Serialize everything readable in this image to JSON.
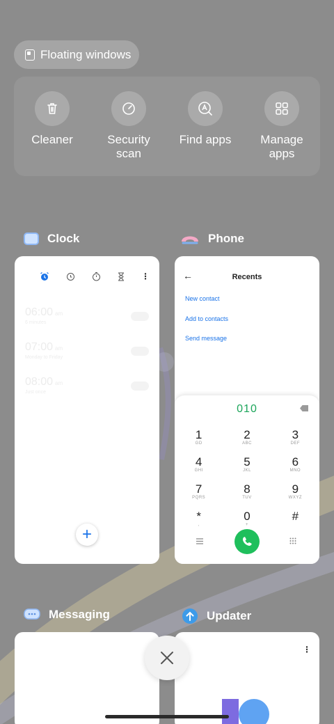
{
  "floating_windows": {
    "label": "Floating windows",
    "icon": "floating-window-icon"
  },
  "tools": [
    {
      "label": "Cleaner",
      "icon": "trash-icon"
    },
    {
      "label": "Security\nscan",
      "icon": "security-scan-icon"
    },
    {
      "label": "Find apps",
      "icon": "find-apps-icon"
    },
    {
      "label": "Manage\napps",
      "icon": "grid-icon"
    }
  ],
  "recent_apps": {
    "clock": {
      "name": "Clock",
      "alarms": [
        {
          "time": "06:00",
          "ampm": "am",
          "repeat": "6 minutes"
        },
        {
          "time": "07:00",
          "ampm": "am",
          "repeat": "Monday to Friday"
        },
        {
          "time": "08:00",
          "ampm": "am",
          "repeat": "Just once"
        }
      ]
    },
    "phone": {
      "name": "Phone",
      "title": "Recents",
      "links": [
        "New contact",
        "Add to contacts",
        "Send message"
      ],
      "dialed_number": "010",
      "keys": [
        {
          "digit": "1",
          "letters": "GD"
        },
        {
          "digit": "2",
          "letters": "ABC"
        },
        {
          "digit": "3",
          "letters": "DEF"
        },
        {
          "digit": "4",
          "letters": "GHI"
        },
        {
          "digit": "5",
          "letters": "JKL"
        },
        {
          "digit": "6",
          "letters": "MNO"
        },
        {
          "digit": "7",
          "letters": "PQRS"
        },
        {
          "digit": "8",
          "letters": "TUV"
        },
        {
          "digit": "9",
          "letters": "WXYZ"
        },
        {
          "digit": "*",
          "letters": ","
        },
        {
          "digit": "0",
          "letters": "+"
        },
        {
          "digit": "#",
          "letters": ""
        }
      ]
    },
    "messaging": {
      "name": "Messaging"
    },
    "updater": {
      "name": "Updater"
    }
  },
  "colors": {
    "accent_blue": "#1a73e8",
    "call_green": "#1fbf5c",
    "dial_number_green": "#1ca55a"
  }
}
